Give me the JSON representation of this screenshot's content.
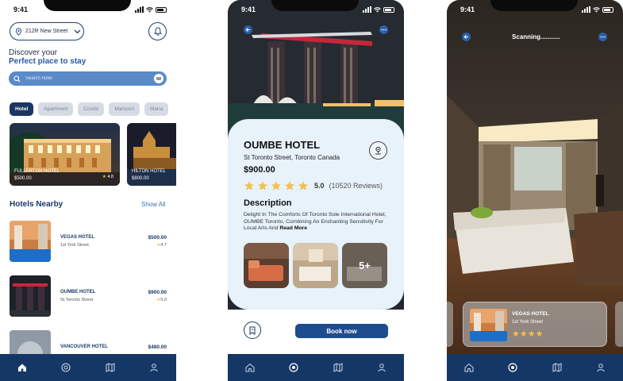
{
  "screens": {
    "home": {
      "status_time": "9:41",
      "location": "212R New Street",
      "greeting_line1": "Discover your",
      "greeting_line2": "Perfect place to stay",
      "search_placeholder": "Search hotel",
      "categories": [
        "Hotel",
        "Apartment",
        "Condo",
        "Mansion",
        "Mana"
      ],
      "featured": [
        {
          "name": "FULLERTON HOTEL",
          "price": "$500.00",
          "rating": "4.8"
        },
        {
          "name": "HILTON HOTEL",
          "price": "$800.00"
        }
      ],
      "nearby_title": "Hotels Nearby",
      "show_all": "Show All",
      "nearby": [
        {
          "name": "VEGAS HOTEL",
          "address": "1st York Street",
          "price": "$500.00",
          "rating": "4.7"
        },
        {
          "name": "OUMBE HOTEL",
          "address": "St Toronto Street",
          "price": "$900.00",
          "rating": "5.0"
        },
        {
          "name": "VANCOUVER HOTEL",
          "address": "",
          "price": "$480.00",
          "rating": ""
        }
      ]
    },
    "detail": {
      "status_time": "9:41",
      "title": "OUMBE HOTEL",
      "address": "St Toronto Street, Toronto Canada",
      "price": "$900.00",
      "rating": "5.0",
      "reviews": "(10520 Reviews)",
      "description_title": "Description",
      "description": "Delight In The Comforts Of Toronto Sole International Hotel, OUMBE Toronto, Combining An Enchanting Sensitivity For Local Arts And",
      "read_more": "Read More",
      "more_photos": "5+",
      "book_label": "Book now"
    },
    "scan": {
      "status_time": "9:41",
      "scanning_label": "Scanning...........",
      "result": {
        "name": "VEGAS HOTEL",
        "address": "1st York Street",
        "stars": "★★★★"
      }
    }
  },
  "colors": {
    "primary": "#153766",
    "accent": "#2a59a4",
    "search_bg": "#5b8ac8",
    "card_bg": "#e7f2fb",
    "star": "#f2c14e"
  },
  "icons": [
    "location-pin-icon",
    "chevron-down-icon",
    "bell-icon",
    "search-icon",
    "filter-icon",
    "star-icon",
    "home-icon",
    "compass-icon",
    "map-icon",
    "user-icon",
    "back-arrow-icon",
    "more-dots-icon",
    "map-pin-icon",
    "bookmark-icon"
  ]
}
